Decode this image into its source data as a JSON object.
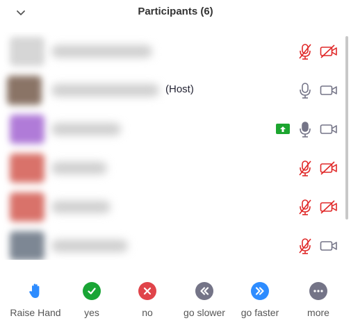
{
  "header": {
    "title": "Participants (6)"
  },
  "participants": [
    {
      "avatar_color": "#d6d6d6",
      "host_tag": "",
      "sharing": false,
      "mic": "muted",
      "video": "off"
    },
    {
      "avatar_color": "#8a7466",
      "host_tag": "(Host)",
      "sharing": false,
      "mic": "on",
      "video": "on"
    },
    {
      "avatar_color": "#b07bd8",
      "host_tag": "",
      "sharing": true,
      "mic": "on",
      "video": "on"
    },
    {
      "avatar_color": "#d9726a",
      "host_tag": "",
      "sharing": false,
      "mic": "muted",
      "video": "off"
    },
    {
      "avatar_color": "#d9726a",
      "host_tag": "",
      "sharing": false,
      "mic": "muted",
      "video": "off"
    },
    {
      "avatar_color": "#7d8794",
      "host_tag": "",
      "sharing": false,
      "mic": "muted",
      "video": "on"
    }
  ],
  "footer": {
    "raise_hand": "Raise Hand",
    "yes": "yes",
    "no": "no",
    "go_slower": "go slower",
    "go_faster": "go faster",
    "more": "more"
  },
  "colors": {
    "muted_red": "#e02828",
    "icon_gray": "#747487",
    "blue": "#2d8cff",
    "green": "#19a535",
    "red": "#e0444a",
    "gray": "#747487"
  }
}
